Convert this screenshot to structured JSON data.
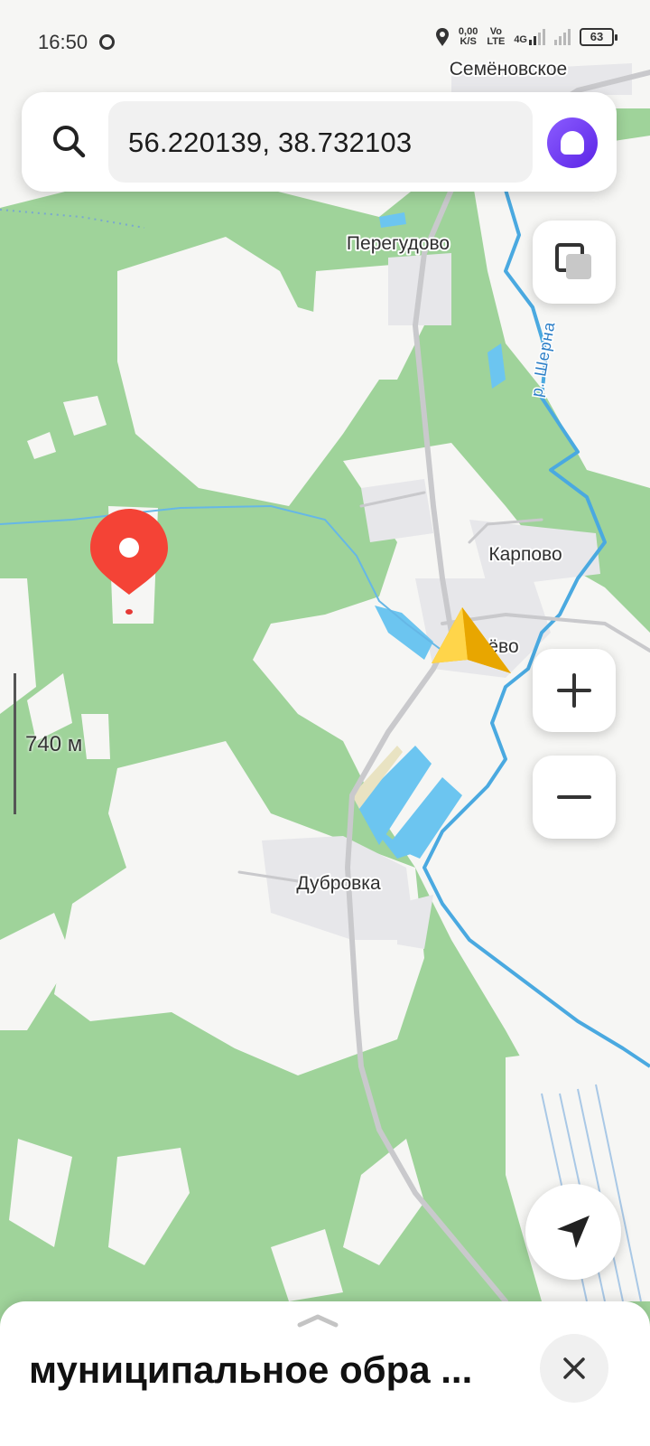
{
  "status_bar": {
    "time": "16:50",
    "net_speed_value": "0,00",
    "net_speed_unit": "K/S",
    "volte_top": "Vo",
    "volte_bottom": "LTE",
    "network": "4G",
    "battery": "63"
  },
  "search": {
    "query": "56.220139, 38.732103"
  },
  "map": {
    "places": {
      "semenovskoe": "Семёновское",
      "peregudovo": "Перегудово",
      "karpovo": "Карпово",
      "center_village": "В…ёво",
      "dubrovka": "Дубровка"
    },
    "river_label": "р. Шерна",
    "scale_text": "740 м"
  },
  "bottom_sheet": {
    "title": "муниципальное обра ..."
  },
  "icons": {
    "search": "search-icon",
    "alice": "alice-icon",
    "layers": "layers-icon",
    "zoom_in": "plus-icon",
    "zoom_out": "minus-icon",
    "locate": "navigation-arrow-icon",
    "close": "close-icon",
    "pin": "location-pin-icon",
    "user": "user-position-arrow-icon"
  },
  "colors": {
    "forest": "#9fd39a",
    "open_area": "#f6f6f4",
    "water": "#6cc5f0",
    "road": "#c9c9cc",
    "pin": "#f44336",
    "user_arrow": "#f5b800",
    "alice": "#6a36f0"
  }
}
